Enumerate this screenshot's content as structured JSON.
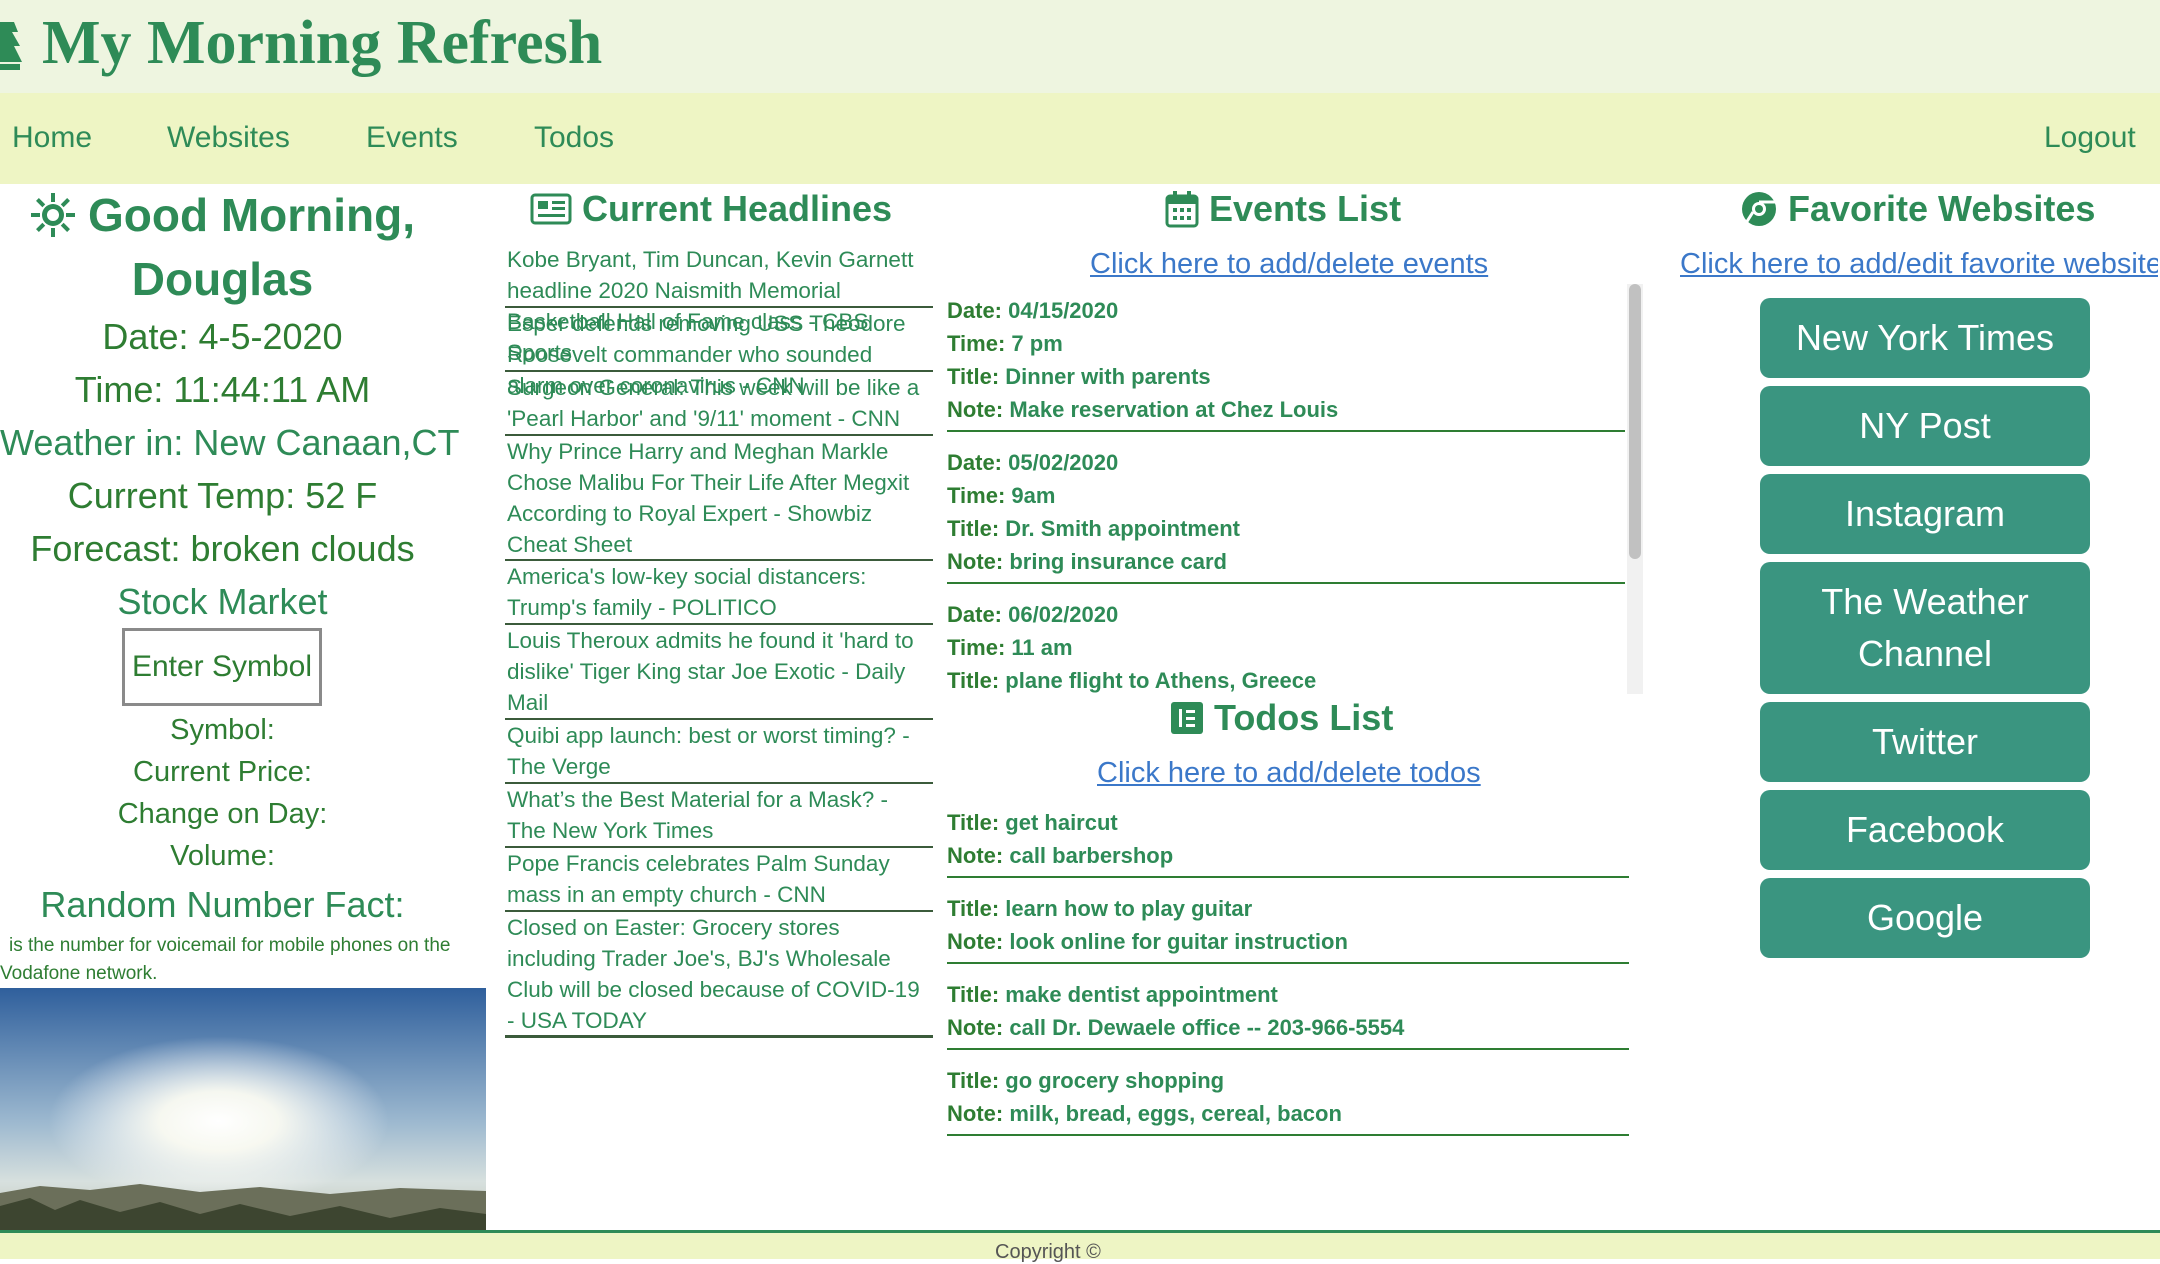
{
  "header": {
    "title": "My Morning Refresh"
  },
  "nav": {
    "home": "Home",
    "websites": "Websites",
    "events": "Events",
    "todos": "Todos",
    "logout": "Logout"
  },
  "greeting": {
    "line1": "Good Morning,",
    "name": "Douglas",
    "date": "Date: 4-5-2020",
    "time": "Time: 11:44:11 AM",
    "weather": "Weather in: New Canaan,CT",
    "temp": "Current Temp: 52 F",
    "forecast": "Forecast: broken clouds"
  },
  "stock": {
    "title": "Stock Market",
    "button": "Enter Symbol",
    "symbol": "Symbol:",
    "price": "Current Price:",
    "change": "Change on Day:",
    "volume": "Volume:"
  },
  "fact": {
    "title": "Random Number Fact:",
    "text": "is the number for voicemail for mobile phones on the Vodafone network."
  },
  "headlines": {
    "title": "Current Headlines",
    "items": [
      "Kobe Bryant, Tim Duncan, Kevin Garnett headline 2020 Naismith Memorial Basketball Hall of Fame class - CBS Sports",
      "Esper defends removing USS Theodore Roosevelt commander who sounded alarm over coronavirus - CNN",
      "Surgeon General: This week will be like a 'Pearl Harbor' and '9/11' moment - CNN",
      "Why Prince Harry and Meghan Markle Chose Malibu For Their Life After Megxit According to Royal Expert - Showbiz Cheat Sheet",
      "America's low-key social distancers: Trump's family - POLITICO",
      "Louis Theroux admits he found it 'hard to dislike' Tiger King star Joe Exotic - Daily Mail",
      "Quibi app launch: best or worst timing? - The Verge",
      "What’s the Best Material for a Mask? - The New York Times",
      "Pope Francis celebrates Palm Sunday mass in an empty church - CNN",
      "Closed on Easter: Grocery stores including Trader Joe's, BJ's Wholesale Club will be closed because of COVID-19 - USA TODAY"
    ]
  },
  "events": {
    "title": "Events List",
    "link": "Click here to add/delete events",
    "labels": {
      "date": "Date:",
      "time": "Time:",
      "title": "Title:",
      "note": "Note:"
    },
    "items": [
      {
        "date": "04/15/2020",
        "time": "7 pm",
        "title": "Dinner with parents",
        "note": "Make reservation at Chez Louis"
      },
      {
        "date": "05/02/2020",
        "time": "9am",
        "title": "Dr. Smith appointment",
        "note": "bring insurance card"
      },
      {
        "date": "06/02/2020",
        "time": "11 am",
        "title": "plane flight to Athens, Greece"
      }
    ]
  },
  "todos": {
    "title": "Todos List",
    "link": "Click here to add/delete todos",
    "labels": {
      "title": "Title:",
      "note": "Note:"
    },
    "items": [
      {
        "title": "get haircut",
        "note": "call barbershop"
      },
      {
        "title": "learn how to play guitar",
        "note": "look online for guitar instruction"
      },
      {
        "title": "make dentist appointment",
        "note": "call Dr. Dewaele office -- 203-966-5554"
      },
      {
        "title": "go grocery shopping",
        "note": "milk, bread, eggs, cereal, bacon"
      }
    ]
  },
  "favorites": {
    "title": "Favorite Websites",
    "link": "Click here to add/edit favorite websites",
    "items": [
      "New York Times",
      "NY Post",
      "Instagram",
      "The Weather Channel",
      "Twitter",
      "Facebook",
      "Google"
    ]
  },
  "footer": {
    "copyright": "Copyright ©"
  },
  "icons": {
    "logo": "house-icon",
    "sun": "sun-icon",
    "news": "newspaper-icon",
    "calendar": "calendar-icon",
    "todo": "list-icon",
    "web": "globe-icon"
  },
  "colors": {
    "primary": "#2e8b57",
    "button": "#3a9580",
    "nav_bg": "#eef5c4",
    "header_bg": "#eef5e0",
    "link": "#3b78c9"
  }
}
